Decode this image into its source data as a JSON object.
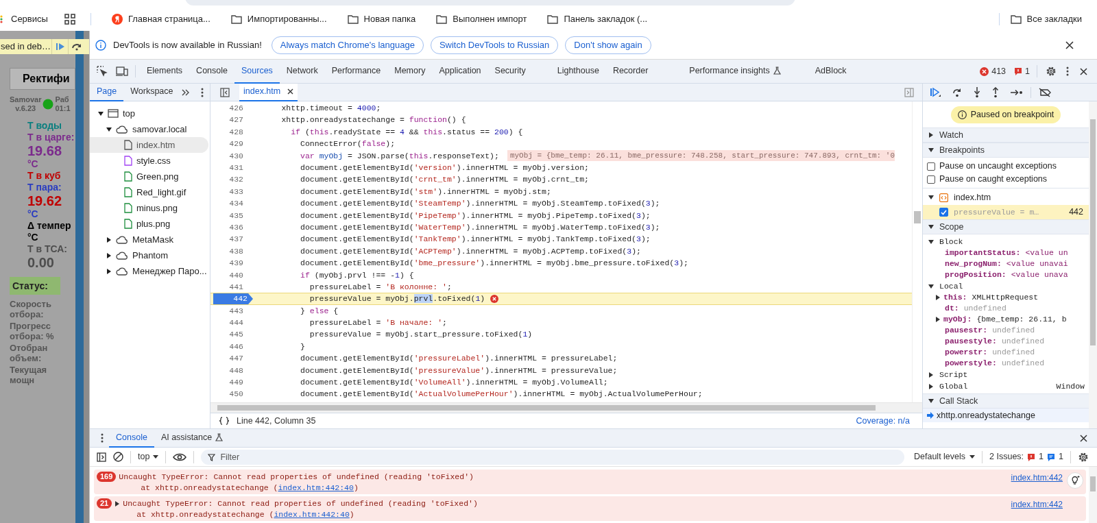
{
  "bookmarks_bar": {
    "items": [
      {
        "kind": "services",
        "label": "Сервисы"
      },
      {
        "kind": "apps"
      },
      {
        "kind": "yandex",
        "label": "Главная страница..."
      },
      {
        "kind": "folder",
        "label": "Импортированны..."
      },
      {
        "kind": "folder",
        "label": "Новая папка"
      },
      {
        "kind": "folder",
        "label": "Выполнен импорт"
      },
      {
        "kind": "folder",
        "label": "Панель закладок (..."
      }
    ],
    "all_bookmarks": "Все закладки"
  },
  "page_behind": {
    "paused_text": "sed in deb…",
    "tab": "Ректифи",
    "device": "Samovar",
    "version": "v.6.23",
    "work_label": "Раб",
    "time": "01:1",
    "readings": [
      {
        "text": "Т воды",
        "color": "#0a7f7f",
        "kind": "label"
      },
      {
        "text": "Т в царге:",
        "color": "#7b2a8c",
        "kind": "label"
      },
      {
        "text": "19.68",
        "color": "#7b2a8c",
        "kind": "value"
      },
      {
        "text": "°C",
        "color": "#7b2a8c",
        "kind": "label"
      },
      {
        "text": "Т в куб",
        "color": "#c00000",
        "kind": "label"
      },
      {
        "text": "Т пара:",
        "color": "#2a3cc0",
        "kind": "label"
      },
      {
        "text": "19.62",
        "color": "#c00000",
        "kind": "value"
      },
      {
        "text": "°C",
        "color": "#2a3cc0",
        "kind": "label"
      },
      {
        "text": "Δ темпер",
        "color": "#000000",
        "kind": "label"
      },
      {
        "text": "°C",
        "color": "#000000",
        "kind": "label"
      },
      {
        "text": "Т в ТСА:",
        "color": "#4d4d4d",
        "kind": "label"
      },
      {
        "text": "0.00",
        "color": "#4d4d4d",
        "kind": "value"
      }
    ],
    "status_label": "Статус:",
    "fields": [
      "Скорость отбора:",
      "Прогресс отбора: %",
      "Отобран объем:",
      "Текущая мощн"
    ]
  },
  "infobar": {
    "message": "DevTools is now available in Russian!",
    "buttons": [
      "Always match Chrome's language",
      "Switch DevTools to Russian",
      "Don't show again"
    ]
  },
  "devtools_tabs": [
    {
      "label": "Elements",
      "selected": false,
      "kind": "plain"
    },
    {
      "label": "Console",
      "selected": false,
      "kind": "plain"
    },
    {
      "label": "Sources",
      "selected": true,
      "kind": "plain"
    },
    {
      "label": "Network",
      "selected": false,
      "kind": "plain"
    },
    {
      "label": "Performance",
      "selected": false,
      "kind": "plain"
    },
    {
      "label": "Memory",
      "selected": false,
      "kind": "plain"
    },
    {
      "label": "Application",
      "selected": false,
      "kind": "plain"
    },
    {
      "label": "Security",
      "selected": false,
      "kind": "plain"
    },
    {
      "label": "Lighthouse",
      "selected": false,
      "kind": "plain"
    },
    {
      "label": "Recorder",
      "selected": false,
      "kind": "plain"
    },
    {
      "label": "Performance insights",
      "selected": false,
      "kind": "experimental"
    },
    {
      "label": "AdBlock",
      "selected": false,
      "kind": "plain"
    }
  ],
  "counters": {
    "errors": "413",
    "issues": "1"
  },
  "navigator": {
    "tabs": [
      {
        "label": "Page",
        "selected": true
      },
      {
        "label": "Workspace",
        "selected": false
      }
    ],
    "tree": [
      {
        "label": "top",
        "kind": "frame",
        "expanded": true,
        "selected": false,
        "children": [
          {
            "label": "samovar.local",
            "kind": "origin",
            "expanded": true,
            "selected": false,
            "children": [
              {
                "label": "index.htm",
                "kind": "html",
                "selected": true
              },
              {
                "label": "style.css",
                "kind": "css",
                "selected": false
              },
              {
                "label": "Green.png",
                "kind": "image",
                "selected": false
              },
              {
                "label": "Red_light.gif",
                "kind": "image",
                "selected": false
              },
              {
                "label": "minus.png",
                "kind": "image",
                "selected": false
              },
              {
                "label": "plus.png",
                "kind": "image",
                "selected": false
              }
            ]
          },
          {
            "label": "MetaMask",
            "kind": "origin",
            "expanded": false,
            "selected": false
          },
          {
            "label": "Phantom",
            "kind": "origin",
            "expanded": false,
            "selected": false
          },
          {
            "label": "Менеджер Паро...",
            "kind": "origin",
            "expanded": false,
            "selected": false
          }
        ]
      }
    ]
  },
  "editor": {
    "file_tab": "index.htm",
    "status": "Line 442, Column 35",
    "coverage": "Coverage: n/a",
    "lines": [
      {
        "num": "426",
        "current": false,
        "breakpoint": false,
        "tokens": [
          {
            "kind": "plain",
            "text": "      xhttp.timeout = "
          },
          {
            "kind": "num",
            "text": "4000"
          },
          {
            "kind": "plain",
            "text": ";"
          }
        ]
      },
      {
        "num": "427",
        "current": false,
        "breakpoint": false,
        "tokens": [
          {
            "kind": "plain",
            "text": "      xhttp.onreadystatechange = "
          },
          {
            "kind": "kw",
            "text": "function"
          },
          {
            "kind": "plain",
            "text": "() {"
          }
        ]
      },
      {
        "num": "428",
        "current": false,
        "breakpoint": false,
        "tokens": [
          {
            "kind": "kw",
            "text": "        if"
          },
          {
            "kind": "plain",
            "text": " ("
          },
          {
            "kind": "kw",
            "text": "this"
          },
          {
            "kind": "plain",
            "text": ".readyState == "
          },
          {
            "kind": "num",
            "text": "4"
          },
          {
            "kind": "plain",
            "text": " && "
          },
          {
            "kind": "kw",
            "text": "this"
          },
          {
            "kind": "plain",
            "text": ".status == "
          },
          {
            "kind": "num",
            "text": "200"
          },
          {
            "kind": "plain",
            "text": ") {"
          }
        ]
      },
      {
        "num": "429",
        "current": false,
        "breakpoint": false,
        "tokens": [
          {
            "kind": "plain",
            "text": "          ConnectError("
          },
          {
            "kind": "kw",
            "text": "false"
          },
          {
            "kind": "plain",
            "text": ");"
          }
        ]
      },
      {
        "num": "430",
        "current": false,
        "breakpoint": false,
        "inline_value": "myObj = {bme_temp: 26.11, bme_pressure: 748.258, start_pressure: 747.893, crnt_tm: '0",
        "tokens": [
          {
            "kind": "kw",
            "text": "          var "
          },
          {
            "kind": "def",
            "text": "myObj"
          },
          {
            "kind": "plain",
            "text": " = JSON.parse("
          },
          {
            "kind": "kw",
            "text": "this"
          },
          {
            "kind": "plain",
            "text": ".responseText);"
          }
        ]
      },
      {
        "num": "431",
        "current": false,
        "breakpoint": false,
        "tokens": [
          {
            "kind": "plain",
            "text": "          document.getElementById("
          },
          {
            "kind": "str",
            "text": "'version'"
          },
          {
            "kind": "plain",
            "text": ").innerHTML = myObj.version;"
          }
        ]
      },
      {
        "num": "432",
        "current": false,
        "breakpoint": false,
        "tokens": [
          {
            "kind": "plain",
            "text": "          document.getElementById("
          },
          {
            "kind": "str",
            "text": "'crnt_tm'"
          },
          {
            "kind": "plain",
            "text": ").innerHTML = myObj.crnt_tm;"
          }
        ]
      },
      {
        "num": "433",
        "current": false,
        "breakpoint": false,
        "tokens": [
          {
            "kind": "plain",
            "text": "          document.getElementById("
          },
          {
            "kind": "str",
            "text": "'stm'"
          },
          {
            "kind": "plain",
            "text": ").innerHTML = myObj.stm;"
          }
        ]
      },
      {
        "num": "434",
        "current": false,
        "breakpoint": false,
        "tokens": [
          {
            "kind": "plain",
            "text": "          document.getElementById("
          },
          {
            "kind": "str",
            "text": "'SteamTemp'"
          },
          {
            "kind": "plain",
            "text": ").innerHTML = myObj.SteamTemp.toFixed("
          },
          {
            "kind": "num",
            "text": "3"
          },
          {
            "kind": "plain",
            "text": ");"
          }
        ]
      },
      {
        "num": "435",
        "current": false,
        "breakpoint": false,
        "tokens": [
          {
            "kind": "plain",
            "text": "          document.getElementById("
          },
          {
            "kind": "str",
            "text": "'PipeTemp'"
          },
          {
            "kind": "plain",
            "text": ").innerHTML = myObj.PipeTemp.toFixed("
          },
          {
            "kind": "num",
            "text": "3"
          },
          {
            "kind": "plain",
            "text": ");"
          }
        ]
      },
      {
        "num": "436",
        "current": false,
        "breakpoint": false,
        "tokens": [
          {
            "kind": "plain",
            "text": "          document.getElementById("
          },
          {
            "kind": "str",
            "text": "'WaterTemp'"
          },
          {
            "kind": "plain",
            "text": ").innerHTML = myObj.WaterTemp.toFixed("
          },
          {
            "kind": "num",
            "text": "3"
          },
          {
            "kind": "plain",
            "text": ");"
          }
        ]
      },
      {
        "num": "437",
        "current": false,
        "breakpoint": false,
        "tokens": [
          {
            "kind": "plain",
            "text": "          document.getElementById("
          },
          {
            "kind": "str",
            "text": "'TankTemp'"
          },
          {
            "kind": "plain",
            "text": ").innerHTML = myObj.TankTemp.toFixed("
          },
          {
            "kind": "num",
            "text": "3"
          },
          {
            "kind": "plain",
            "text": ");"
          }
        ]
      },
      {
        "num": "438",
        "current": false,
        "breakpoint": false,
        "tokens": [
          {
            "kind": "plain",
            "text": "          document.getElementById("
          },
          {
            "kind": "str",
            "text": "'ACPTemp'"
          },
          {
            "kind": "plain",
            "text": ").innerHTML = myObj.ACPTemp.toFixed("
          },
          {
            "kind": "num",
            "text": "3"
          },
          {
            "kind": "plain",
            "text": ");"
          }
        ]
      },
      {
        "num": "439",
        "current": false,
        "breakpoint": false,
        "tokens": [
          {
            "kind": "plain",
            "text": "          document.getElementById("
          },
          {
            "kind": "str",
            "text": "'bme_pressure'"
          },
          {
            "kind": "plain",
            "text": ").innerHTML = myObj.bme_pressure.toFixed("
          },
          {
            "kind": "num",
            "text": "3"
          },
          {
            "kind": "plain",
            "text": ");"
          }
        ]
      },
      {
        "num": "440",
        "current": false,
        "breakpoint": false,
        "tokens": [
          {
            "kind": "kw",
            "text": "          if"
          },
          {
            "kind": "plain",
            "text": " (myObj.prvl !== -"
          },
          {
            "kind": "num",
            "text": "1"
          },
          {
            "kind": "plain",
            "text": ") {"
          }
        ]
      },
      {
        "num": "441",
        "current": false,
        "breakpoint": false,
        "tokens": [
          {
            "kind": "plain",
            "text": "            pressureLabel = "
          },
          {
            "kind": "str",
            "text": "'В колонне: '"
          },
          {
            "kind": "plain",
            "text": ";"
          }
        ]
      },
      {
        "num": "442",
        "current": true,
        "breakpoint": true,
        "error": true,
        "tokens": [
          {
            "kind": "plain",
            "text": "            pressureValue = myObj."
          },
          {
            "kind": "sel",
            "text": "prvl"
          },
          {
            "kind": "plain",
            "text": ".toFixed("
          },
          {
            "kind": "num",
            "text": "1"
          },
          {
            "kind": "plain",
            "text": ")"
          }
        ]
      },
      {
        "num": "443",
        "current": false,
        "breakpoint": false,
        "tokens": [
          {
            "kind": "plain",
            "text": "          } "
          },
          {
            "kind": "kw",
            "text": "else"
          },
          {
            "kind": "plain",
            "text": " {"
          }
        ]
      },
      {
        "num": "444",
        "current": false,
        "breakpoint": false,
        "tokens": [
          {
            "kind": "plain",
            "text": "            pressureLabel = "
          },
          {
            "kind": "str",
            "text": "'В начале: '"
          },
          {
            "kind": "plain",
            "text": ";"
          }
        ]
      },
      {
        "num": "445",
        "current": false,
        "breakpoint": false,
        "tokens": [
          {
            "kind": "plain",
            "text": "            pressureValue = myObj.start_pressure.toFixed("
          },
          {
            "kind": "num",
            "text": "1"
          },
          {
            "kind": "plain",
            "text": ")"
          }
        ]
      },
      {
        "num": "446",
        "current": false,
        "breakpoint": false,
        "tokens": [
          {
            "kind": "plain",
            "text": "          }"
          }
        ]
      },
      {
        "num": "447",
        "current": false,
        "breakpoint": false,
        "tokens": [
          {
            "kind": "plain",
            "text": "          document.getElementById("
          },
          {
            "kind": "str",
            "text": "'pressureLabel'"
          },
          {
            "kind": "plain",
            "text": ").innerHTML = pressureLabel;"
          }
        ]
      },
      {
        "num": "448",
        "current": false,
        "breakpoint": false,
        "tokens": [
          {
            "kind": "plain",
            "text": "          document.getElementById("
          },
          {
            "kind": "str",
            "text": "'pressureValue'"
          },
          {
            "kind": "plain",
            "text": ").innerHTML = pressureValue;"
          }
        ]
      },
      {
        "num": "449",
        "current": false,
        "breakpoint": false,
        "tokens": [
          {
            "kind": "plain",
            "text": "          document.getElementById("
          },
          {
            "kind": "str",
            "text": "'VolumeAll'"
          },
          {
            "kind": "plain",
            "text": ").innerHTML = myObj.VolumeAll;"
          }
        ]
      },
      {
        "num": "450",
        "current": false,
        "breakpoint": false,
        "tokens": [
          {
            "kind": "plain",
            "text": "          document.getElementById("
          },
          {
            "kind": "str",
            "text": "'ActualVolumePerHour'"
          },
          {
            "kind": "plain",
            "text": ").innerHTML = myObj.ActualVolumePerHour;"
          }
        ]
      }
    ]
  },
  "debugger": {
    "paused_message": "Paused on breakpoint",
    "watch": {
      "label": "Watch",
      "expanded": false
    },
    "breakpoints": {
      "label": "Breakpoints",
      "expanded": true,
      "options": [
        {
          "label": "Pause on uncaught exceptions",
          "checked": false
        },
        {
          "label": "Pause on caught exceptions",
          "checked": false
        }
      ],
      "file": "index.htm",
      "entries": [
        {
          "code": "pressureValue = m…",
          "line": "442",
          "checked": true
        }
      ]
    },
    "scope": {
      "label": "Scope",
      "expanded": true,
      "groups": [
        {
          "label": "Block",
          "expanded": true,
          "vars": [
            {
              "name": "importantStatus:",
              "value": "<value un",
              "kind": "unavailable"
            },
            {
              "name": "new_progNum:",
              "value": "<value unavai",
              "kind": "unavailable"
            },
            {
              "name": "progPosition:",
              "value": "<value unava",
              "kind": "unavailable"
            }
          ]
        },
        {
          "label": "Local",
          "expanded": true,
          "vars": [
            {
              "name": "this:",
              "value": "XMLHttpRequest",
              "kind": "object"
            },
            {
              "name": "dt:",
              "value": "undefined",
              "kind": "undefined"
            },
            {
              "name": "myObj:",
              "value": "{bme_temp: 26.11, b",
              "kind": "object"
            },
            {
              "name": "pausestr:",
              "value": "undefined",
              "kind": "undefined"
            },
            {
              "name": "pausestyle:",
              "value": "undefined",
              "kind": "undefined"
            },
            {
              "name": "powerstr:",
              "value": "undefined",
              "kind": "undefined"
            },
            {
              "name": "powerstyle:",
              "value": "undefined",
              "kind": "undefined"
            }
          ]
        },
        {
          "label": "Script",
          "expanded": false
        },
        {
          "label": "Global",
          "expanded": false,
          "value": "Window"
        }
      ]
    },
    "call_stack": {
      "label": "Call Stack",
      "expanded": true,
      "frames": [
        {
          "name": "xhttp.onreadystatechange",
          "selected": true
        }
      ]
    }
  },
  "drawer": {
    "tabs": [
      {
        "label": "Console",
        "selected": true,
        "kind": "plain"
      },
      {
        "label": "AI assistance",
        "selected": false,
        "kind": "experimental"
      }
    ],
    "context": "top",
    "filter_placeholder": "Filter",
    "levels": "Default levels",
    "issues_label": "2 Issues:",
    "issue_errors": "1",
    "issue_info": "1",
    "messages": [
      {
        "count": "169",
        "kind": "plain",
        "text": "Uncaught TypeError: Cannot read properties of undefined (reading 'toFixed')",
        "trace_prefix": "at xhttp.onreadystatechange (",
        "trace_link": "index.htm:442:40",
        "trace_suffix": ")",
        "source": "index.htm:442"
      },
      {
        "count": "21",
        "kind": "expandable",
        "text": "Uncaught TypeError: Cannot read properties of undefined (reading 'toFixed')",
        "trace_prefix": "at xhttp.onreadystatechange (",
        "trace_link": "index.htm:442:40",
        "trace_suffix": ")",
        "source": "index.htm:442"
      }
    ]
  }
}
